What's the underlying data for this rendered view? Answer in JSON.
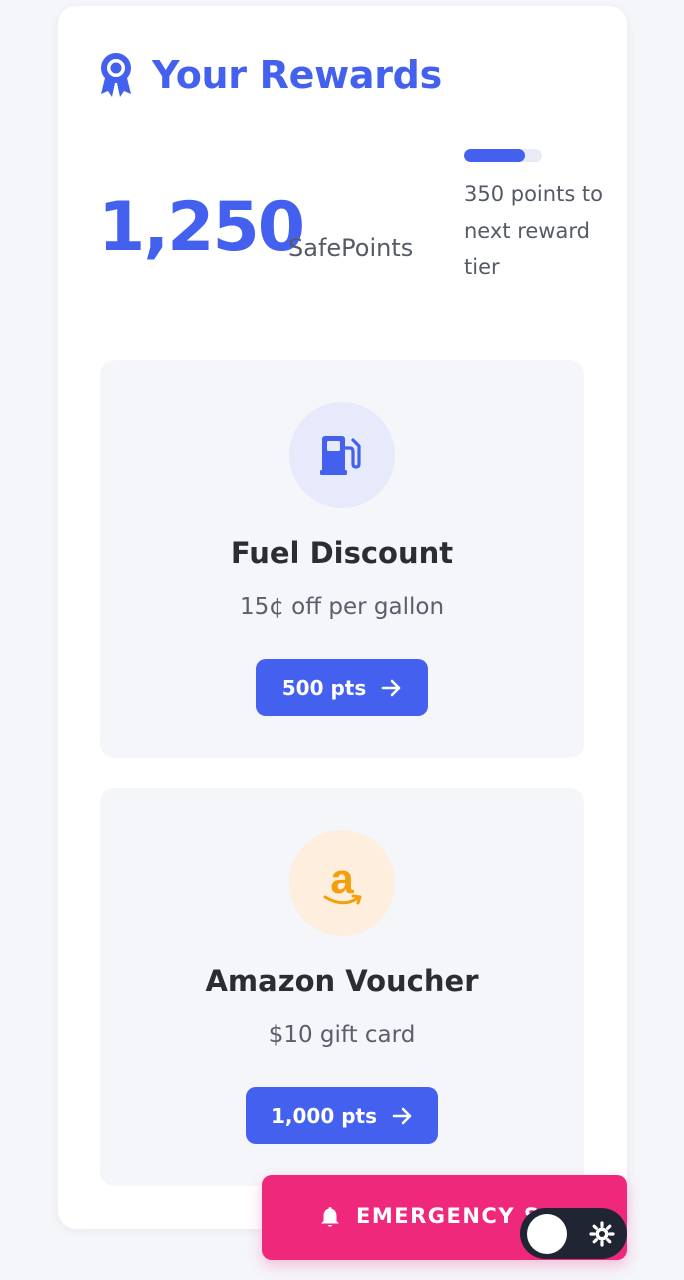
{
  "header": {
    "title": "Your Rewards",
    "icon": "award-icon"
  },
  "points": {
    "value": "1,250",
    "unit": "SafePoints",
    "next_tier_text": "350 points to next reward tier",
    "progress_fraction": 0.78
  },
  "rewards": [
    {
      "icon": "gas-pump-icon",
      "name": "Fuel Discount",
      "description": "15¢ off per gallon",
      "button_label": "500 pts"
    },
    {
      "icon": "amazon-logo-icon",
      "icon_text": "a",
      "name": "Amazon Voucher",
      "description": "$10 gift card",
      "button_label": "1,000 pts"
    }
  ],
  "emergency": {
    "label": "EMERGENCY S",
    "icon": "bell-icon"
  },
  "theme_toggle": {
    "icon": "sun-icon",
    "state": "off"
  },
  "colors": {
    "accent": "#4361ee",
    "emergency": "#f0287c",
    "amazon": "#f59e0b",
    "toggle_bg": "#1f2533"
  }
}
